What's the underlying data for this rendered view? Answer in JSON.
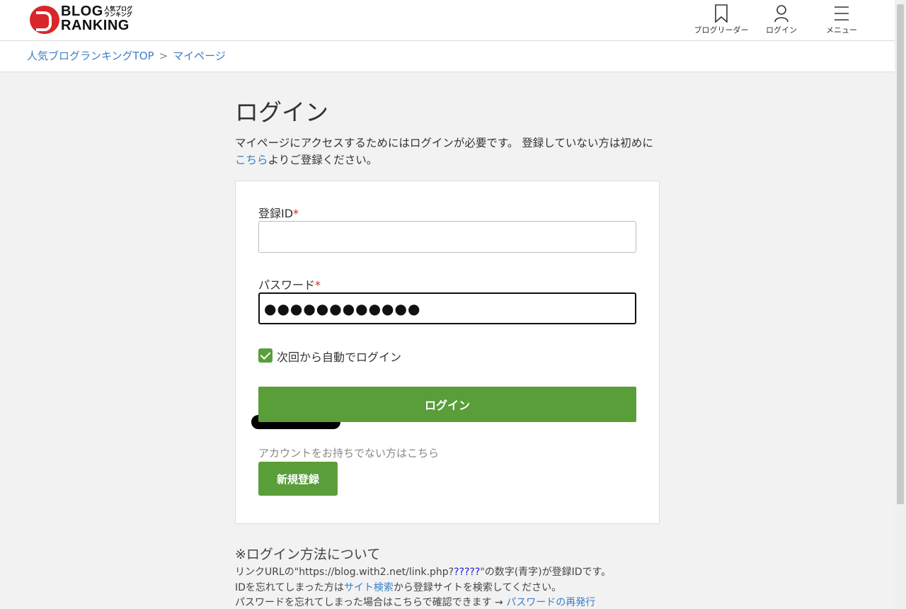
{
  "header": {
    "logo": {
      "top": "BLOG",
      "bottom": "RANKING",
      "sub": "人気ブログランキング"
    },
    "nav": {
      "reader": "ブログリーダー",
      "login": "ログイン",
      "menu": "メニュー"
    },
    "icons": {
      "reader": "bookmark-icon",
      "login": "user-icon",
      "menu": "hamburger-icon"
    }
  },
  "breadcrumb": {
    "home": "人気ブログランキングTOP",
    "separator": ">",
    "current": "マイページ"
  },
  "main": {
    "title": "ログイン",
    "intro_before": "マイページにアクセスするためにはログインが必要です。 登録していない方は初めに",
    "intro_link": "こちら",
    "intro_after": "よりご登録ください。"
  },
  "form": {
    "id_label": "登録ID",
    "password_label": "パスワード",
    "required_mark": "*",
    "password_value": "●●●●●●●●●●●●",
    "auto_login_label": "次回から自動でログイン",
    "auto_login_checked": true,
    "login_button": "ログイン",
    "no_account_text": "アカウントをお持ちでない方はこちら",
    "signup_button": "新規登録"
  },
  "notes": {
    "title": "※ログイン方法について",
    "line1_before": "リンクURLの\"https://blog.with2.net/link.php?",
    "line1_blue": "?????",
    "line1_after": "\"の数字(青字)が登録IDです。",
    "line2_before": "IDを忘れてしまった方は",
    "line2_link": "サイト検索",
    "line2_after": "から登録サイトを検索してください。",
    "line3_before": "パスワードを忘れてしまった場合はこちらで確認できます → ",
    "line3_link": "パスワードの再発行"
  },
  "colors": {
    "accent_green": "#5a9e3a",
    "link_blue": "#3b7ec6",
    "required_red": "#d9262a"
  }
}
